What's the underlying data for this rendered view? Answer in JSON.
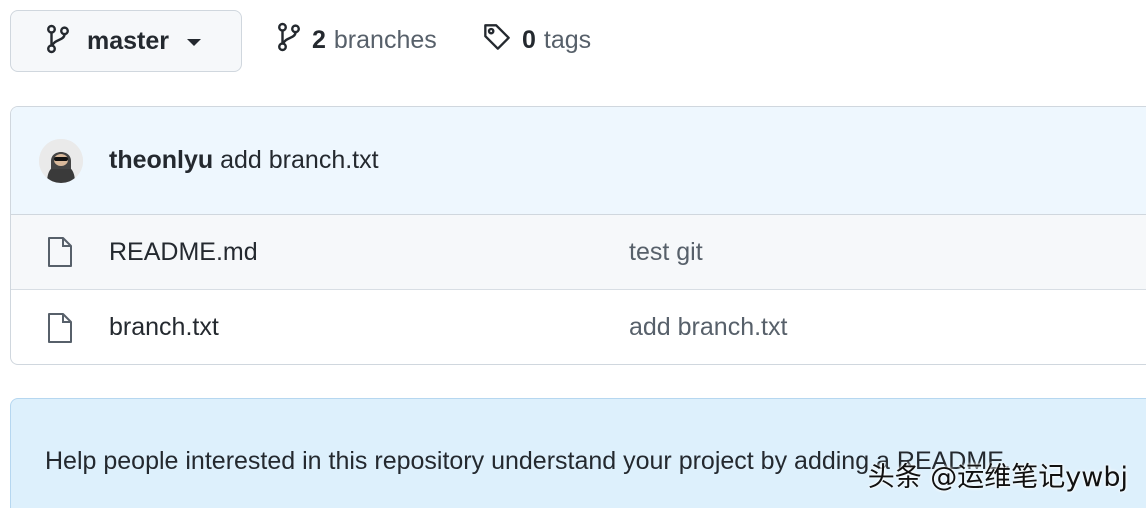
{
  "branch_selector": {
    "label": "master"
  },
  "branches": {
    "count": "2",
    "word": "branches"
  },
  "tags": {
    "count": "0",
    "word": "tags"
  },
  "latest_commit": {
    "author": "theonlyu",
    "message": "add branch.txt"
  },
  "files": [
    {
      "name": "README.md",
      "commit_message": "test git"
    },
    {
      "name": "branch.txt",
      "commit_message": "add branch.txt"
    }
  ],
  "readme_prompt": {
    "text": "Help people interested in this repository understand your project by adding a README."
  },
  "watermark": {
    "text": "头条 @运维笔记ywbj"
  },
  "colors": {
    "accent_bg": "#ddf4ff",
    "border": "#d0d7de",
    "text": "#24292f",
    "muted": "#57606a"
  }
}
